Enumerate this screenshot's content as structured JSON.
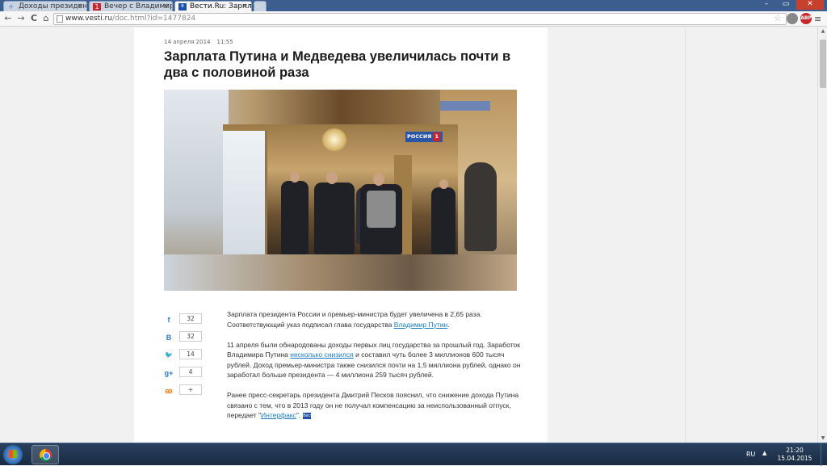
{
  "tabs": [
    {
      "label": "Доходы президента",
      "favicon": "plane-icon",
      "active": false
    },
    {
      "label": "Вечер с Владимиром",
      "favicon": "channel-one-icon",
      "active": false
    },
    {
      "label": "Вести.Ru: Зарплата",
      "favicon": "vesti-icon",
      "active": true
    }
  ],
  "tab_close": "×",
  "window_buttons": {
    "minimize": "–",
    "maximize": "▭",
    "close": "✕"
  },
  "address_bar": {
    "host": "www.vesti.ru",
    "path": "/doc.html?id=1477824"
  },
  "toolbar": {
    "back": "←",
    "forward": "→",
    "reload": "C",
    "home": "⌂",
    "star": "☆",
    "menu": "≡"
  },
  "extensions": [
    {
      "name": "extension-icon",
      "label": "",
      "color": "#888888"
    },
    {
      "name": "abp-icon",
      "label": "ABP",
      "color": "#c8262c"
    }
  ],
  "article": {
    "date": "14 апреля 2014",
    "time": "11:55",
    "title": "Зарплата Путина и Медведева увеличилась почти в два с половиной раза",
    "logo": {
      "text": "РОССИЯ",
      "badge": "1"
    },
    "paragraphs": {
      "p1_a": "Зарплата президента России и премьер-министра будет увеличена в 2,65 раза. Соответствующий указ подписал глава государства ",
      "p1_link": "Владимир Путин",
      "p1_b": ".",
      "p2_a": "11 апреля были обнародованы доходы первых лиц государства за прошлый год. Заработок Владимира Путина ",
      "p2_link": "несколько снизился",
      "p2_b": " и составил чуть более 3 миллионов 600 тысяч рублей. Доход премьер-министра также снизился почти на 1,5 миллиона рублей, однако он заработал больше президента — 4 миллиона 259 тысяч рублей.",
      "p3_a": "Ранее пресс-секретарь президента Дмитрий Песков пояснил, что снижение дохода Путина связано с тем, что в 2013 году он не получал компенсацию за неиспользованный отпуск, передает \"",
      "p3_link": "Интерфакс",
      "p3_b": "\".",
      "source_icon": "Вести"
    }
  },
  "share": [
    {
      "network": "facebook",
      "glyph": "f",
      "count": "32"
    },
    {
      "network": "vkontakte",
      "glyph": "В",
      "count": "32"
    },
    {
      "network": "twitter",
      "glyph": "🐦",
      "count": "14"
    },
    {
      "network": "google-plus",
      "glyph": "g+",
      "count": "4"
    },
    {
      "network": "odnoklassniki",
      "glyph": "ꙭ",
      "count": "+"
    }
  ],
  "colors": {
    "link": "#1a7bc4",
    "share_icon": "#2c7ac8",
    "taskbar": "#1a2b42"
  },
  "taskbar": {
    "language": "RU",
    "time": "21:20",
    "date": "15.04.2015",
    "tray_arrow": "▲"
  },
  "scrollbar": {
    "up": "▲",
    "down": "▼"
  }
}
